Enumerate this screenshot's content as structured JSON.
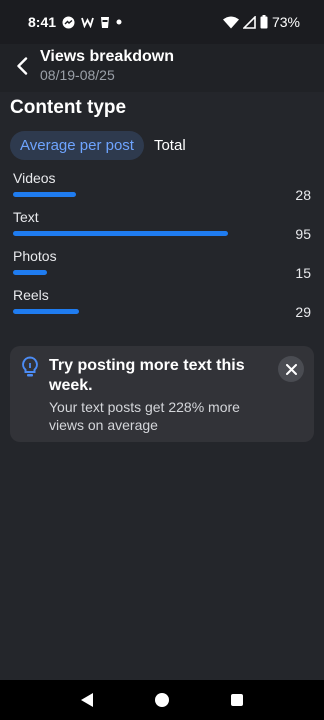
{
  "status_bar": {
    "time": "8:41",
    "battery": "73%",
    "icons": [
      "messenger-icon",
      "w-icon",
      "cup-icon",
      "dot-icon",
      "wifi-icon",
      "signal-icon",
      "battery-icon"
    ]
  },
  "header": {
    "title": "Views breakdown",
    "subtitle": "08/19-08/25"
  },
  "section": {
    "title": "Content type",
    "tabs": [
      {
        "label": "Average per post",
        "active": true
      },
      {
        "label": "Total",
        "active": false
      }
    ]
  },
  "rows": [
    {
      "label": "Videos",
      "value": "28",
      "bar_color": "#1f7cf0"
    },
    {
      "label": "Text",
      "value": "95",
      "bar_color": "#1f7cf0"
    },
    {
      "label": "Photos",
      "value": "15",
      "bar_color": "#1f7cf0"
    },
    {
      "label": "Reels",
      "value": "29",
      "bar_color": "#1f7cf0"
    }
  ],
  "tip": {
    "title": "Try posting more text this week.",
    "body": "Your text posts get 228% more views on average",
    "icon": "lightbulb-icon",
    "accent": "#4c8cf5"
  },
  "nav": {
    "icons": [
      "back-triangle-icon",
      "home-circle-icon",
      "recents-square-icon"
    ]
  }
}
